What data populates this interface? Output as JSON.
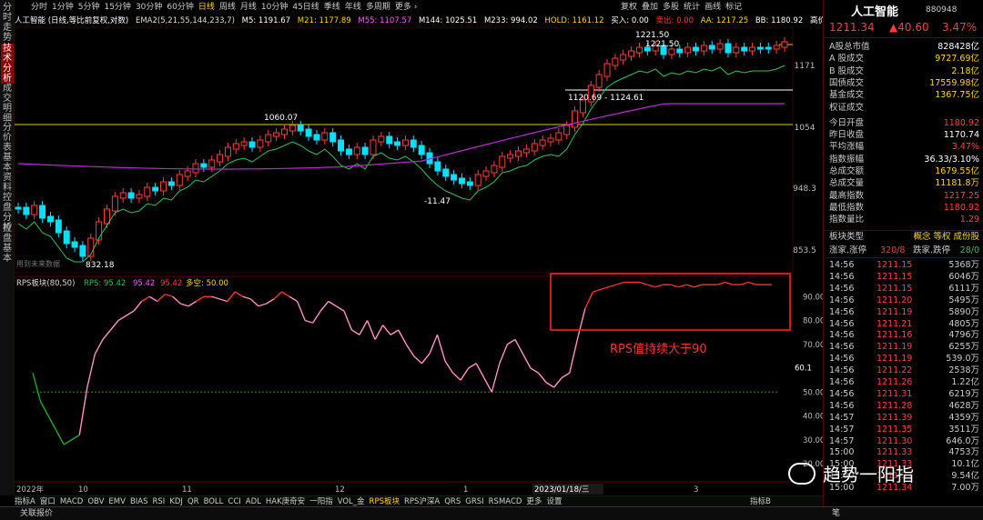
{
  "vertical_tabs": [
    "分时走势",
    "技术分析",
    "成交明细",
    "分价表",
    "基本资料",
    "控盘分析",
    "控盘基本"
  ],
  "toolbar": {
    "items": [
      "分时",
      "1分钟",
      "5分钟",
      "15分钟",
      "30分钟",
      "60分钟",
      "日线",
      "周线",
      "月线",
      "10分钟",
      "45日线",
      "季线",
      "年线",
      "多周期",
      "更多 ›"
    ],
    "active": "日线",
    "right_items": [
      "复权",
      "叠加",
      "多股",
      "统计",
      "画线",
      "标记"
    ]
  },
  "indicator_bar": {
    "title": "人工智能 (日线,等比前复权,对数)",
    "ema": "EMA2(5,21,55,144,233,7)",
    "m5": "M5: 1191.67",
    "m21": "M21: 1177.89",
    "m55": "M55: 1107.57",
    "m144": "M144: 1025.51",
    "m233": "M233: 994.02",
    "hold": "HOLD: 1161.12",
    "buy": "买入: 0.00",
    "sell": "卖出: 0.00",
    "aa": "AA: 1217.25",
    "bb": "BB: 1180.92",
    "high": "高价: 121"
  },
  "main_chart": {
    "price_axis": [
      "1171",
      "1054",
      "948.3",
      "853.5"
    ],
    "annotations": {
      "peak": "1221.50",
      "peak2": "1221.50",
      "left_high": "1060.07",
      "left_low": "832.18",
      "mid_low": "-11.47",
      "range": "1120.69 - 1124.61"
    },
    "future_note": "用到未来数据"
  },
  "rps": {
    "header": "RPS板块(80,50)",
    "line1": "RPS: 95.42",
    "line2": "95.42",
    "line3": "95.42",
    "line4": "多空: 50.00",
    "axis": [
      "90.00",
      "80.00",
      "70.00",
      "60.1",
      "50.00",
      "40.00",
      "30.00",
      "20.00"
    ],
    "note": "RPS值持续大于90"
  },
  "date_axis": {
    "labels": [
      "2022年",
      "10",
      "11",
      "12",
      "1",
      "2023/01/18/三",
      "3"
    ]
  },
  "bottom_tabs": {
    "items": [
      "指标A",
      "窗口",
      "MACD",
      "OBV",
      "EMV",
      "BIAS",
      "RSI",
      "KDJ",
      "QR",
      "BOLL",
      "CCI",
      "ADL",
      "HAK庚奇安",
      "一阳指",
      "VOL_金",
      "RPS板块",
      "RPS沪深A",
      "QRS",
      "GRSI",
      "RSMACD",
      "更多",
      "设置"
    ],
    "active": "RPS板块",
    "right": "指标B"
  },
  "status_bar": {
    "left": "关联报价",
    "right": "笔"
  },
  "right_panel": {
    "name": "人工智能",
    "code": "880948",
    "price": "1211.34",
    "change": "▲40.60",
    "pct": "3.47%",
    "stats": [
      {
        "label": "A股总市值",
        "value": "828428亿",
        "color": "#ffffff"
      },
      {
        "label": "A 股成交",
        "value": "9727.69亿",
        "color": "#ffd600"
      },
      {
        "label": "B 股成交",
        "value": "2.18亿",
        "color": "#ffd600"
      },
      {
        "label": "国债成交",
        "value": "17559.98亿",
        "color": "#ffd600"
      },
      {
        "label": "基金成交",
        "value": "1367.75亿",
        "color": "#ffd600"
      },
      {
        "label": "权证成交",
        "value": "",
        "color": "#ffd600"
      },
      {
        "label": "今日开盘",
        "value": "1180.92",
        "color": "#ff4040"
      },
      {
        "label": "昨日收盘",
        "value": "1170.74",
        "color": "#ffffff"
      },
      {
        "label": "平均涨幅",
        "value": "3.47%",
        "color": "#ff4040"
      },
      {
        "label": "指数振幅",
        "value": "36.33/3.10%",
        "color": "#ffffff"
      },
      {
        "label": "总成交额",
        "value": "1679.55亿",
        "color": "#ffd600"
      },
      {
        "label": "总成交量",
        "value": "11181.8万",
        "color": "#ffd600"
      },
      {
        "label": "最高指数",
        "value": "1217.25",
        "color": "#ff4040"
      },
      {
        "label": "最低指数",
        "value": "1180.92",
        "color": "#ff4040"
      },
      {
        "label": "指数量比",
        "value": "1.29",
        "color": "#ff4040"
      }
    ],
    "sector_type_label": "板块类型",
    "sector_type_value": "概念 等权 成份股",
    "updown": {
      "label1": "涨家.涨停",
      "v1": "320/8",
      "label2": "跌家.跌停",
      "v2": "28/0"
    },
    "ticks": [
      {
        "t": "14:56",
        "p": "1211.15",
        "q": "5368万"
      },
      {
        "t": "14:56",
        "p": "1211.15",
        "q": "6046万"
      },
      {
        "t": "14:56",
        "p": "1211.15",
        "q": "6111万"
      },
      {
        "t": "14:56",
        "p": "1211.20",
        "q": "5495万"
      },
      {
        "t": "14:56",
        "p": "1211.19",
        "q": "5890万"
      },
      {
        "t": "14:56",
        "p": "1211.21",
        "q": "4805万"
      },
      {
        "t": "14:56",
        "p": "1211.16",
        "q": "4796万"
      },
      {
        "t": "14:56",
        "p": "1211.19",
        "q": "6255万"
      },
      {
        "t": "14:56",
        "p": "1211.19",
        "q": "539.0万"
      },
      {
        "t": "14:56",
        "p": "1211.22",
        "q": "2538万"
      },
      {
        "t": "14:56",
        "p": "1211.26",
        "q": "1.22亿"
      },
      {
        "t": "14:56",
        "p": "1211.31",
        "q": "6219万"
      },
      {
        "t": "14:56",
        "p": "1211.28",
        "q": "4628万"
      },
      {
        "t": "14:57",
        "p": "1211.39",
        "q": "4359万"
      },
      {
        "t": "14:57",
        "p": "1211.35",
        "q": "3511万"
      },
      {
        "t": "14:57",
        "p": "1211.30",
        "q": "646.0万"
      },
      {
        "t": "15:00",
        "p": "1211.33",
        "q": "4753万"
      },
      {
        "t": "15:00",
        "p": "1211.33",
        "q": "10.1亿"
      },
      {
        "t": "15:00",
        "p": "1211.33",
        "q": "9.54亿"
      },
      {
        "t": "15:00",
        "p": "1211.34",
        "q": "7.00万"
      }
    ]
  },
  "watermark": "趋势一阳指",
  "colors": {
    "up": "#ff3b3b",
    "down": "#00e0ff",
    "green_ma": "#22c55e",
    "purple_ma": "#c026d3",
    "yellow_line": "#d4d400",
    "rps_line": "#ff3030",
    "rps_pink": "#ff8fc8",
    "rps_green": "#22aa22",
    "highlight_box": "#ff2020"
  },
  "chart_data": {
    "type": "line",
    "title": "",
    "series": [
      {
        "name": "RPS",
        "values": [
          58,
          46,
          40,
          34,
          28,
          30,
          32,
          52,
          66,
          72,
          76,
          80,
          82,
          84,
          88,
          90,
          88,
          91,
          90,
          87,
          86,
          88,
          90,
          90,
          89,
          88,
          92,
          90,
          89,
          86,
          87,
          89,
          92,
          90,
          88,
          80,
          79,
          84,
          88,
          86,
          84,
          76,
          74,
          80,
          72,
          78,
          74,
          76,
          70,
          65,
          62,
          66,
          74,
          63,
          58,
          55,
          60,
          62,
          56,
          50,
          62,
          70,
          72,
          66,
          60,
          58,
          54,
          52,
          56,
          58,
          72,
          85,
          92,
          93,
          94,
          95,
          96,
          96,
          96,
          95,
          94,
          95,
          95,
          94,
          95,
          94,
          95,
          95,
          95,
          96,
          95,
          95,
          96,
          95,
          95,
          95
        ]
      }
    ],
    "ylim": [
      20,
      100
    ],
    "threshold": 50,
    "ma_levels": {
      "M5": "1191.67",
      "M21": "1177.89",
      "M55": "1107.57",
      "M144": "1025.51",
      "M233": "994.02"
    }
  }
}
